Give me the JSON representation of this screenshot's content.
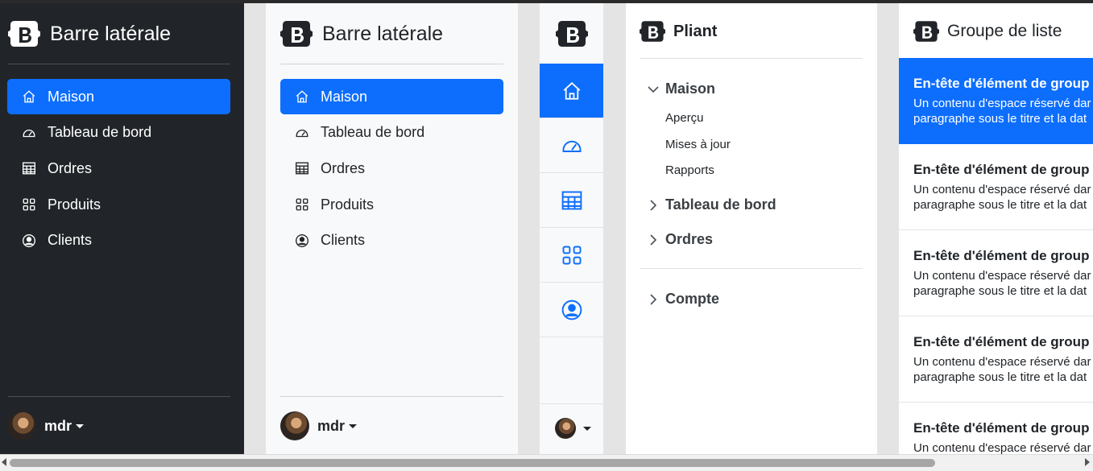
{
  "sidebar_dark": {
    "brand": "Barre latérale",
    "nav": [
      {
        "label": "Maison",
        "icon": "home-icon",
        "active": true
      },
      {
        "label": "Tableau de bord",
        "icon": "speedometer-icon"
      },
      {
        "label": "Ordres",
        "icon": "table-icon"
      },
      {
        "label": "Produits",
        "icon": "grid-icon"
      },
      {
        "label": "Clients",
        "icon": "person-circle-icon"
      }
    ],
    "user": "mdr"
  },
  "sidebar_light": {
    "brand": "Barre latérale",
    "nav": [
      {
        "label": "Maison",
        "icon": "home-icon",
        "active": true
      },
      {
        "label": "Tableau de bord",
        "icon": "speedometer-icon"
      },
      {
        "label": "Ordres",
        "icon": "table-icon"
      },
      {
        "label": "Produits",
        "icon": "grid-icon"
      },
      {
        "label": "Clients",
        "icon": "person-circle-icon"
      }
    ],
    "user": "mdr"
  },
  "icon_sidebar": {
    "items": [
      "home-icon",
      "speedometer-icon",
      "table-icon",
      "grid-icon",
      "person-circle-icon"
    ]
  },
  "collapsible": {
    "brand": "Pliant",
    "sections": [
      {
        "label": "Maison",
        "expanded": true,
        "items": [
          "Aperçu",
          "Mises à jour",
          "Rapports"
        ]
      },
      {
        "label": "Tableau de bord",
        "expanded": false
      },
      {
        "label": "Ordres",
        "expanded": false
      },
      {
        "label": "Compte",
        "expanded": false
      }
    ]
  },
  "list_group": {
    "brand": "Groupe de liste",
    "item_title": "En-tête d'élément de group",
    "item_line1": "Un contenu d'espace réservé dar",
    "item_line2": "paragraphe sous le titre et la dat"
  },
  "colors": {
    "accent": "#0d6efd",
    "dark_bg": "#212529",
    "light_bg": "#f8f9fa"
  }
}
